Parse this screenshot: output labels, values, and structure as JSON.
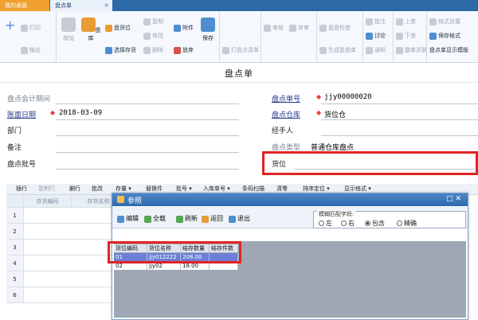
{
  "tabs": [
    {
      "label": "我的桌面"
    },
    {
      "label": "盘点单",
      "close": "×"
    }
  ],
  "ribbon": {
    "new_label": "+",
    "print": "打印",
    "export": "输出",
    "add": "增加",
    "modify_inv": "盘库",
    "cargo": "盘货位",
    "select_goods": "选择存货",
    "copy": "复制",
    "modify": "修改",
    "delete": "删除",
    "attach": "附件",
    "abandon": "放弃",
    "save": "保存",
    "print_list": "打盘点清单",
    "audit": "审核",
    "abandon_audit": "弃审",
    "recheck": "复盘检查",
    "gen_recheck": "生成复盘单",
    "annotate": "批注",
    "discuss": "讨论",
    "notify": "通知",
    "prev": "上查",
    "next": "下查",
    "link": "整单关联",
    "format_set": "格式设置",
    "save_format": "保存格式",
    "display_template": "盘点单显示模版"
  },
  "page_title": "盘点单",
  "form": {
    "period_label": "盘点会计期间",
    "doc_no_label": "盘点单号",
    "doc_no": "jjy00000020",
    "book_date_label": "账面日期",
    "book_date": "2018-03-09",
    "warehouse_label": "盘点仓库",
    "warehouse": "货位仓",
    "dept_label": "部门",
    "handler_label": "经手人",
    "remark_label": "备注",
    "type_label": "盘点类型",
    "type_value": "普通仓库盘点",
    "batch_label": "盘点批号",
    "location_label": "货位"
  },
  "grid_toolbar": [
    "插行",
    "复制行",
    "删行",
    "批改",
    "存量 ▾",
    "替换件",
    "批号 ▾",
    "入库单号 ▾",
    "条码扫描",
    "清零",
    "排序定位 ▾",
    "显示格式 ▾"
  ],
  "grid": {
    "col1": "存货编码",
    "col2": "存货名称",
    "rows": [
      "1",
      "2",
      "3",
      "4",
      "5",
      "6"
    ]
  },
  "dialog": {
    "title": "参照",
    "controls": "□ ✕",
    "buttons": [
      "编辑",
      "全载",
      "刷新",
      "返回",
      "退出"
    ],
    "match_title": "模糊匹配字段:",
    "radios": [
      "左",
      "右",
      "包含",
      "精确"
    ],
    "selected_radio": "包含",
    "columns": [
      "货位编码",
      "货位名称",
      "结存数量",
      "结存件数"
    ],
    "rows": [
      [
        "01",
        "jjy012222",
        "208.00",
        ""
      ],
      [
        "02",
        "jjy02",
        "18.00",
        ""
      ]
    ]
  },
  "colors": {
    "tab_active": "#e9f1fb",
    "tab_desk": "#f0a030",
    "highlight_red": "#e02424",
    "selected_row": "#6b7fd6"
  }
}
